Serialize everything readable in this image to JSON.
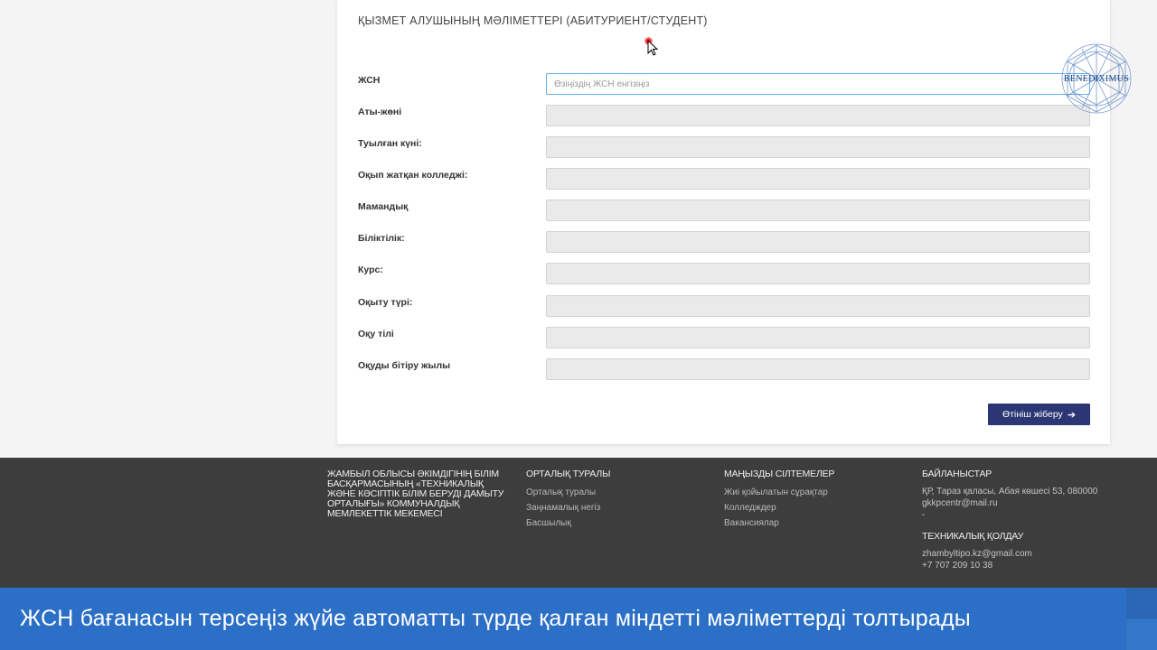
{
  "form": {
    "section_title": "ҚЫЗМЕТ АЛУШЫНЫҢ МӘЛІМЕТТЕРІ (АБИТУРИЕНТ/СТУДЕНТ)",
    "iin_label": "ЖСН",
    "iin_placeholder": "Өзіңіздің ЖСН енгізіңіз",
    "fullname_label": "Аты-жөні",
    "birthdate_label": "Туылған күні:",
    "college_label": "Оқып жатқан колледжі:",
    "specialty_label": "Мамандық",
    "qualification_label": "Біліктілік:",
    "course_label": "Курс:",
    "study_form_label": "Оқыту түрі:",
    "language_label": "Оқу тілі",
    "grad_year_label": "Оқуды бітіру жылы",
    "submit_label": "Өтініш жіберу",
    "submit_icon": "arrow-right-icon"
  },
  "logo": {
    "text": "BENEDIXIMUS"
  },
  "footer": {
    "org_name": "ЖАМБЫЛ ОБЛЫСЫ ӘКІМДІГІНІҢ БІЛІМ БАСҚАРМАСЫНЫҢ «ТЕХНИКАЛЫҚ ЖӘНЕ КӘСІПТІК БІЛІМ БЕРУДІ ДАМЫТУ ОРТАЛЫҒЫ» КОММУНАЛДЫҚ МЕМЛЕКЕТТІК МЕКЕМЕСІ",
    "about_title": "ОРТАЛЫҚ ТУРАЛЫ",
    "about_links": [
      "Орталық туралы",
      "Заңнамалық негіз",
      "Басшылық"
    ],
    "links_title": "МАҢЫЗДЫ СІЛТЕМЕЛЕР",
    "important_links": [
      "Жиі қойылатын сұрақтар",
      "Колледждер",
      "Вакансиялар"
    ],
    "contacts_title": "БАЙЛАНЫСТАР",
    "address": "ҚР, Тараз қаласы, Абая көшесі 53, 080000",
    "email": "gkkpcentr@mail.ru",
    "dash": "-",
    "support_title": "ТЕХНИКАЛЫҚ ҚОЛДАУ",
    "support_email": "zhambyltipo.kz@gmail.com",
    "support_phone": "+7 707 209 10 38"
  },
  "caption": {
    "text": "ЖСН бағанасын терсеңіз жүйе автоматты түрде қалған міндетті мәліметтерді толтырады"
  },
  "colors": {
    "button_bg": "#2b3674",
    "footer_bg": "#3d3d3d",
    "caption_bg": "#2b6fc6",
    "active_input_border": "#66afe9"
  }
}
